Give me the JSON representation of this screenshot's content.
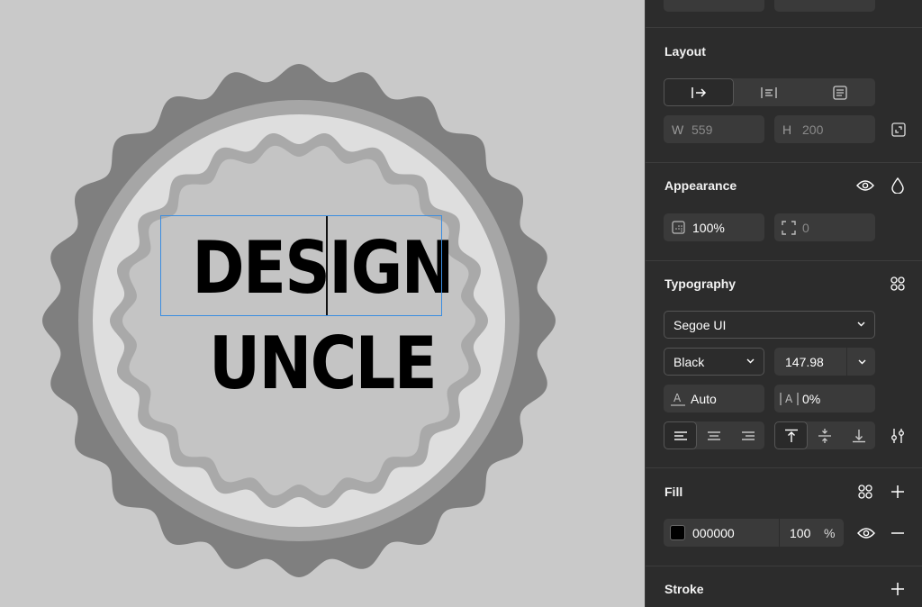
{
  "canvas": {
    "badge": {
      "line1": "DESIGN",
      "line2": "UNCLE",
      "colors": {
        "outer": "#7f7f7f",
        "ring": "#a6a6a6",
        "inner_light": "#dedede",
        "wave": "#a9a9a9",
        "center": "#c4c4c4",
        "text": "#000000",
        "selection": "#3a8de0"
      }
    }
  },
  "panel": {
    "layout": {
      "title": "Layout",
      "width_label": "W",
      "width_value": "559",
      "height_label": "H",
      "height_value": "200"
    },
    "appearance": {
      "title": "Appearance",
      "opacity_value": "100%",
      "radius_value": "0"
    },
    "typography": {
      "title": "Typography",
      "font_family": "Segoe UI",
      "font_weight": "Black",
      "font_size": "147.98",
      "line_height": "Auto",
      "letter_spacing": "0%"
    },
    "fill": {
      "title": "Fill",
      "hex": "000000",
      "opacity": "100",
      "percent": "%",
      "swatch_color": "#000000"
    },
    "stroke": {
      "title": "Stroke"
    }
  }
}
